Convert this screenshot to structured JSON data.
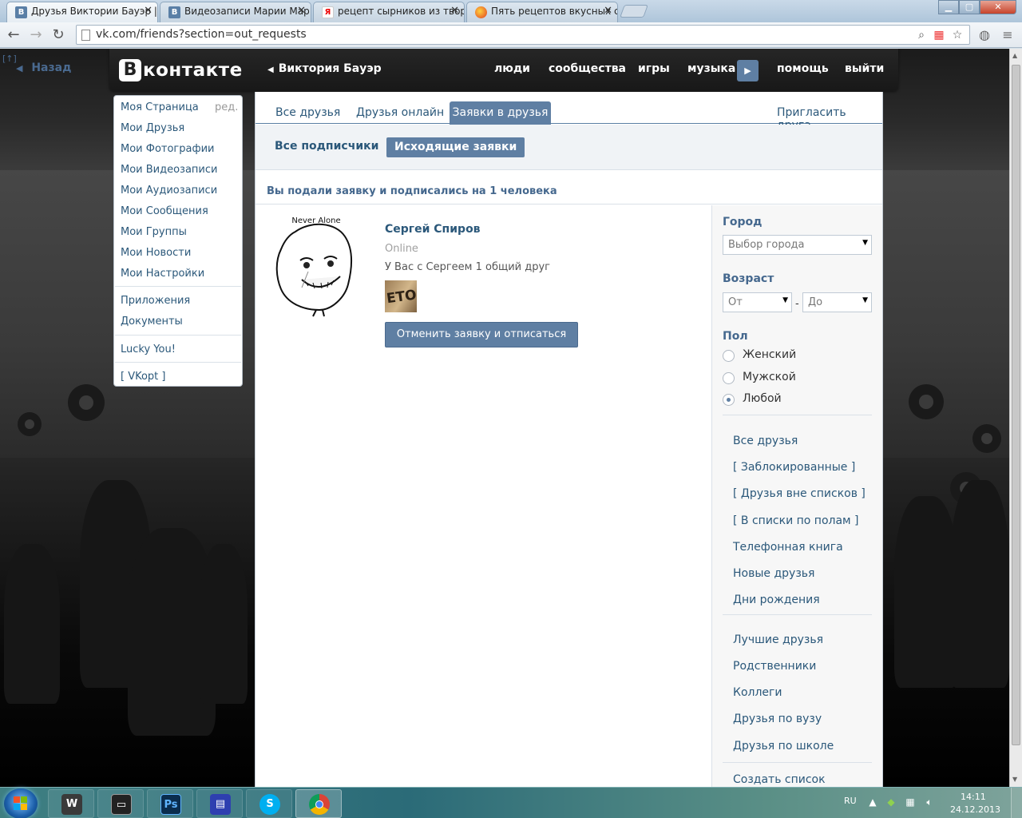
{
  "browser": {
    "tabs": [
      {
        "label": "Друзья Виктории Бауэр |",
        "favicon": "vk-icon",
        "active": true
      },
      {
        "label": "Видеозаписи Марии Мар",
        "favicon": "vk-icon"
      },
      {
        "label": "рецепт сырников из твор",
        "favicon": "yandex-icon"
      },
      {
        "label": "Пять рецептов вкусных с",
        "favicon": "site-icon"
      }
    ],
    "close_glyph": "✕",
    "url": "vk.com/friends?section=out_requests"
  },
  "left_stub": {
    "badge": "[↑]",
    "back_label": "Назад"
  },
  "header": {
    "logo_letter": "В",
    "logo_text": "контакте",
    "owner": "Виктория Бауэр",
    "nav": [
      "люди",
      "сообщества",
      "игры",
      "музыка",
      "помощь",
      "выйти"
    ]
  },
  "left_menu": {
    "edit_label": "ред.",
    "items": [
      "Моя Страница",
      "Мои Друзья",
      "Мои Фотографии",
      "Мои Видеозаписи",
      "Мои Аудиозаписи",
      "Мои Сообщения",
      "Мои Группы",
      "Мои Новости",
      "Мои Настройки"
    ],
    "extra": [
      "Приложения",
      "Документы"
    ],
    "lucky": "Lucky You!",
    "vkopt": "[ VKopt ]"
  },
  "content": {
    "tabs": [
      "Все друзья",
      "Друзья онлайн",
      "Заявки в друзья"
    ],
    "invite": "Пригласить друга",
    "subtabs": [
      "Все подписчики",
      "Исходящие заявки"
    ],
    "summary": "Вы подали заявку и подписались на 1 человека",
    "person": {
      "name": "Сергей Спиров",
      "status": "Online",
      "mutual": "У Вас с Сергеем 1 общий друг",
      "mutual_thumb_text": "ETOS",
      "avatar_caption": "Never Alone",
      "cancel_button": "Отменить заявку и отписаться"
    }
  },
  "filter": {
    "city_label": "Город",
    "city_placeholder": "Выбор города",
    "age_label": "Возраст",
    "age_from": "От",
    "age_dash": "-",
    "age_to": "До",
    "sex_label": "Пол",
    "sex_options": [
      "Женский",
      "Мужской",
      "Любой"
    ],
    "sex_selected": "Любой",
    "links_a": [
      "Все друзья",
      "[ Заблокированные ]",
      "[ Друзья вне списков ]",
      "[ В списки по полам ]",
      "Телефонная книга",
      "Новые друзья",
      "Дни рождения"
    ],
    "links_b": [
      "Лучшие друзья",
      "Родственники",
      "Коллеги",
      "Друзья по вузу",
      "Друзья по школе",
      "Создать список"
    ]
  },
  "taskbar": {
    "lang": "RU",
    "time": "14:11",
    "date": "24.12.2013",
    "apps": [
      "world-of-tanks-icon",
      "media-icon",
      "photoshop-icon",
      "save-icon",
      "skype-icon",
      "chrome-icon"
    ]
  }
}
